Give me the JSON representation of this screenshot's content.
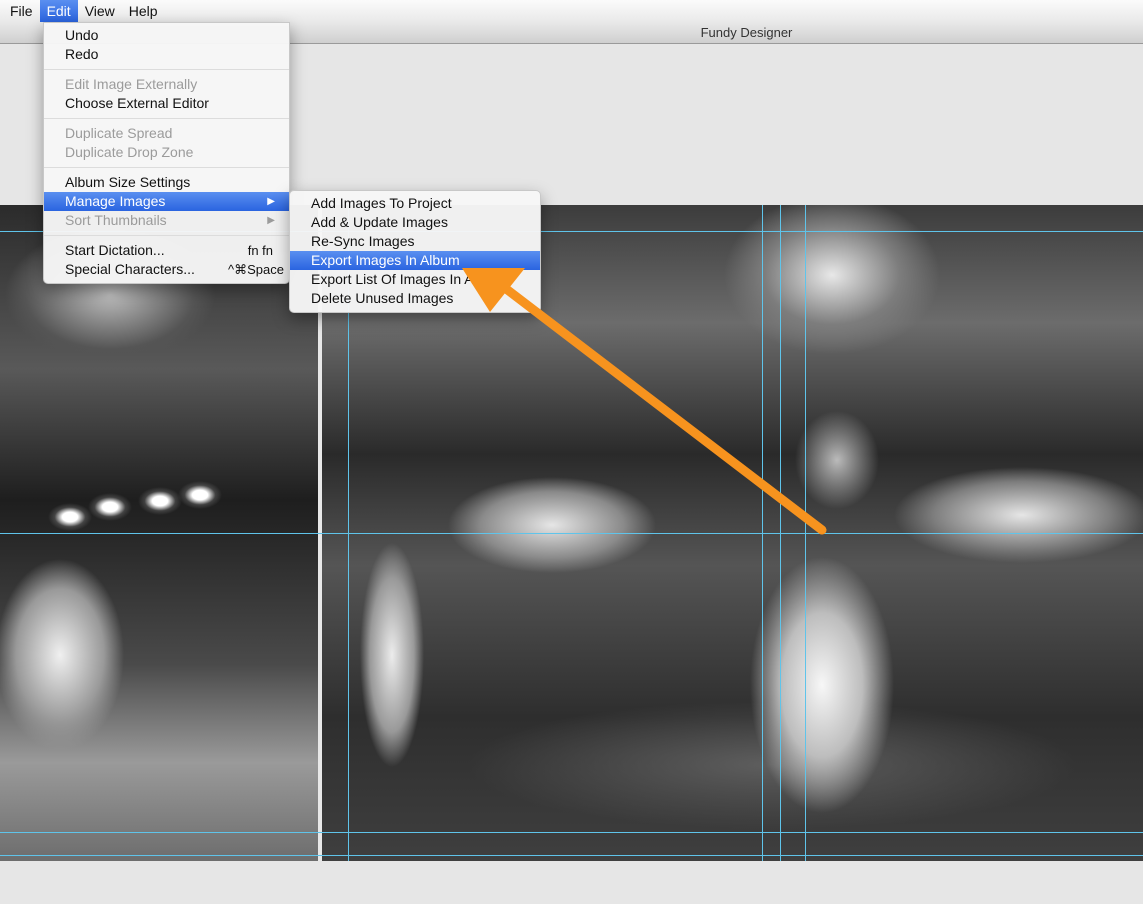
{
  "menubar": {
    "items": [
      "File",
      "Edit",
      "View",
      "Help"
    ]
  },
  "window": {
    "title": "Fundy Designer"
  },
  "edit_menu": {
    "undo": "Undo",
    "redo": "Redo",
    "edit_image_externally": "Edit Image Externally",
    "choose_external_editor": "Choose External Editor",
    "duplicate_spread": "Duplicate Spread",
    "duplicate_drop_zone": "Duplicate Drop Zone",
    "album_size_settings": "Album Size Settings",
    "manage_images": "Manage Images",
    "sort_thumbnails": "Sort Thumbnails",
    "start_dictation": "Start Dictation...",
    "start_dictation_shortcut": "fn fn",
    "special_characters": "Special Characters...",
    "special_characters_shortcut": "^⌘Space"
  },
  "manage_images_submenu": {
    "items": [
      "Add Images To Project",
      "Add & Update Images",
      "Re-Sync Images",
      "Export Images In Album",
      "Export List Of Images In Album",
      "Delete Unused Images"
    ],
    "highlighted": "Export Images In Album"
  },
  "annotation": {
    "arrow_color": "#f7931e"
  },
  "colors": {
    "menu_highlight": "#3b74e6",
    "guide_line": "#5fc4ea"
  }
}
